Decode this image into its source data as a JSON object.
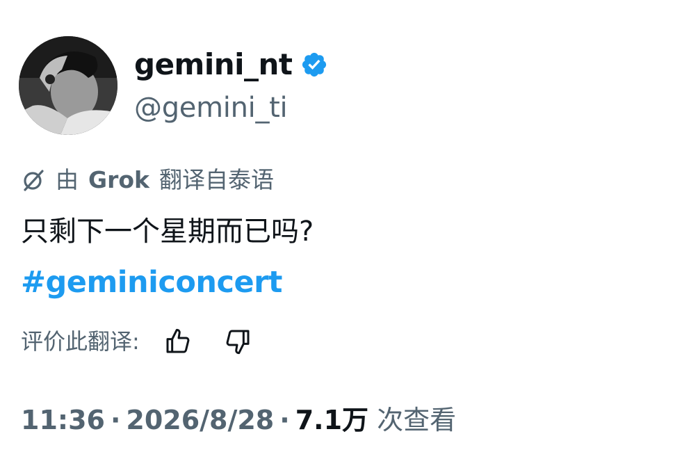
{
  "profile": {
    "display_name": "gemini_nt",
    "handle": "@gemini_ti",
    "avatar_icon": "profile-photo",
    "verified_color": "#1d9bf0"
  },
  "translation": {
    "prefix": "由",
    "provider": "Grok",
    "suffix": "翻译自泰语",
    "icon": "grok-icon"
  },
  "tweet": {
    "text": "只剩下一个星期而已吗?",
    "hashtag": "#geminiconcert",
    "hashtag_color": "#1d9bf0"
  },
  "rating": {
    "label": "评价此翻译:",
    "thumbs_up_icon": "thumbs-up-icon",
    "thumbs_down_icon": "thumbs-down-icon"
  },
  "meta": {
    "time": "11:36",
    "separator": "·",
    "date": "2026/8/28",
    "views_count": "7.1万",
    "views_label": "次查看"
  },
  "colors": {
    "text_primary": "#0f1419",
    "text_secondary": "#536471",
    "accent": "#1d9bf0"
  }
}
